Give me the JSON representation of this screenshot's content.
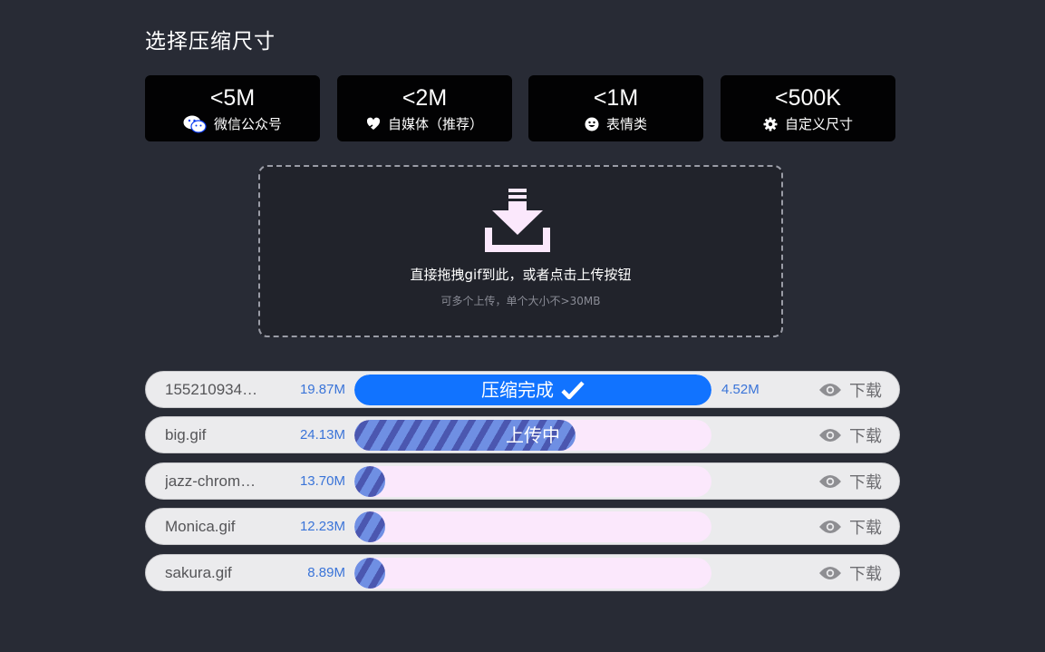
{
  "title": "选择压缩尺寸",
  "size_options": [
    {
      "size": "<5M",
      "label": "微信公众号",
      "icon": "wechat-icon",
      "active": true
    },
    {
      "size": "<2M",
      "label": "自媒体（推荐）",
      "icon": "heart-hand-icon",
      "active": false
    },
    {
      "size": "<1M",
      "label": "表情类",
      "icon": "smile-icon",
      "active": false
    },
    {
      "size": "<500K",
      "label": "自定义尺寸",
      "icon": "gear-icon",
      "active": false
    }
  ],
  "upload": {
    "main_text": "直接拖拽gif到此，或者点击上传按钮",
    "sub_text": "可多个上传，单个大小不>30MB",
    "icon": "download-tray-icon"
  },
  "files": [
    {
      "name": "155210934…",
      "size": "19.87M",
      "status": "压缩完成",
      "progress": 1.0,
      "result_size": "4.52M",
      "state": "done"
    },
    {
      "name": "big.gif",
      "size": "24.13M",
      "status": "上传中",
      "progress": 0.62,
      "result_size": "",
      "state": "uploading"
    },
    {
      "name": "jazz-chrom…",
      "size": "13.70M",
      "status": "",
      "progress": 0.0,
      "result_size": "",
      "state": "pending"
    },
    {
      "name": "Monica.gif",
      "size": "12.23M",
      "status": "",
      "progress": 0.0,
      "result_size": "",
      "state": "pending"
    },
    {
      "name": "sakura.gif",
      "size": "8.89M",
      "status": "",
      "progress": 0.0,
      "result_size": "",
      "state": "pending"
    }
  ],
  "download_label": "下载",
  "colors": {
    "background": "#282b35",
    "active_option": "#0a3cf2",
    "done_bar": "#1173ff",
    "track": "#fbe8fc",
    "size_text": "#3a74d8"
  }
}
